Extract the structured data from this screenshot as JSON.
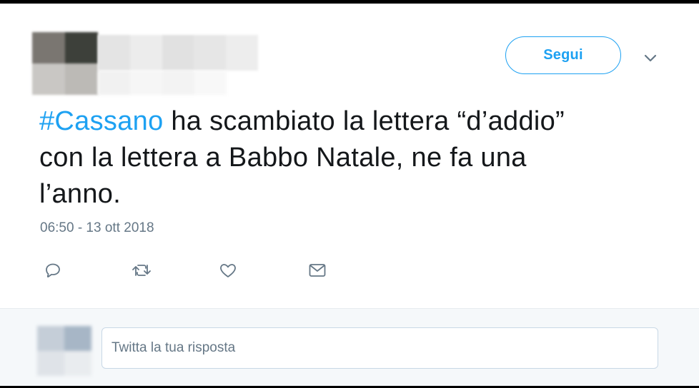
{
  "header": {
    "follow_label": "Segui"
  },
  "tweet": {
    "hashtag": "#Cassano",
    "text_line1_rest": " ha scambiato la lettera “d’addio”",
    "text_line2": "con la lettera a Babbo Natale, ne fa una",
    "text_line3": "l’anno.",
    "timestamp": "06:50 - 13 ott 2018"
  },
  "actions": {
    "icons": [
      "reply-icon",
      "retweet-icon",
      "like-icon",
      "direct-message-icon"
    ]
  },
  "reply": {
    "placeholder": "Twitta la tua risposta"
  },
  "colors": {
    "accent": "#1da1f2",
    "text": "#14171a",
    "muted": "#657786",
    "reply_bg": "#f5f8fa"
  }
}
